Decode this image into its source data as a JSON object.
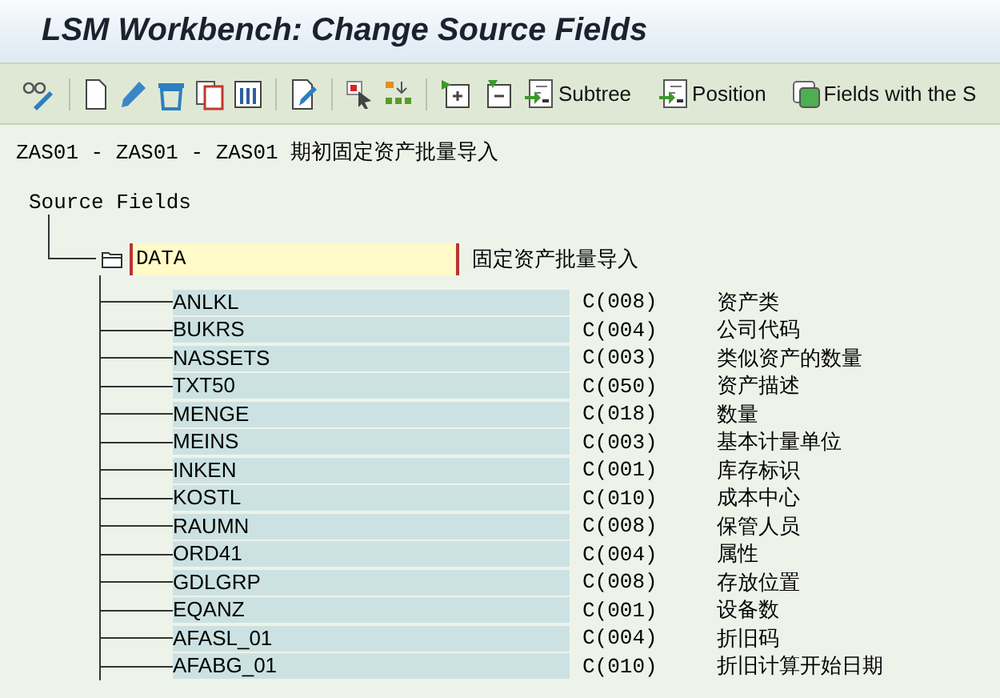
{
  "window": {
    "title": "LSM Workbench: Change Source Fields"
  },
  "toolbar": {
    "buttons": [
      {
        "label": "Subtree"
      },
      {
        "label": "Position"
      },
      {
        "label": "Fields with the S"
      }
    ]
  },
  "header": "ZAS01 - ZAS01 - ZAS01 期初固定资产批量导入",
  "tree": {
    "label": "Source Fields",
    "children": [
      {
        "name": "DATA",
        "description": "固定资产批量导入",
        "children": [
          {
            "name": "ANLKL",
            "type": "C(008)",
            "description": "资产类"
          },
          {
            "name": "BUKRS",
            "type": "C(004)",
            "description": "公司代码"
          },
          {
            "name": "NASSETS",
            "type": "C(003)",
            "description": "类似资产的数量"
          },
          {
            "name": "TXT50",
            "type": "C(050)",
            "description": "资产描述"
          },
          {
            "name": "MENGE",
            "type": "C(018)",
            "description": "数量"
          },
          {
            "name": "MEINS",
            "type": "C(003)",
            "description": "基本计量单位"
          },
          {
            "name": "INKEN",
            "type": "C(001)",
            "description": "库存标识"
          },
          {
            "name": "KOSTL",
            "type": "C(010)",
            "description": "成本中心"
          },
          {
            "name": "RAUMN",
            "type": "C(008)",
            "description": "保管人员"
          },
          {
            "name": "ORD41",
            "type": "C(004)",
            "description": "属性"
          },
          {
            "name": "GDLGRP",
            "type": "C(008)",
            "description": "存放位置"
          },
          {
            "name": "EQANZ",
            "type": "C(001)",
            "description": "设备数"
          },
          {
            "name": "AFASL_01",
            "type": "C(004)",
            "description": "折旧码"
          },
          {
            "name": "AFABG_01",
            "type": "C(010)",
            "description": "折旧计算开始日期"
          }
        ]
      }
    ]
  }
}
